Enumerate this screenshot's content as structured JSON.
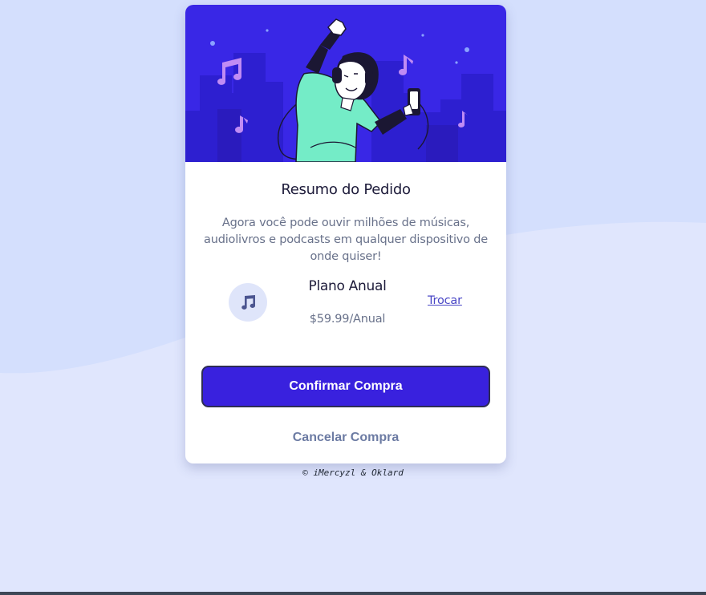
{
  "card": {
    "title": "Resumo do Pedido",
    "description": "Agora você pode ouvir milhões de músicas, audiolivros e podcasts em qualquer dispositivo de onde quiser!",
    "hero_icon": "illustration-person-dancing-with-headphones"
  },
  "plan": {
    "icon": "music-note-icon",
    "name": "Plano Anual",
    "price": "$59.99/Anual",
    "change_label": "Trocar"
  },
  "actions": {
    "confirm_label": "Confirmar Compra",
    "cancel_label": "Cancelar Compra"
  },
  "footer": {
    "text": "© iMercyzl & Oklard"
  },
  "colors": {
    "page_bg": "#e0e6fd",
    "hero_bg": "#3927e6",
    "primary": "#3921de",
    "muted": "#68718a"
  }
}
